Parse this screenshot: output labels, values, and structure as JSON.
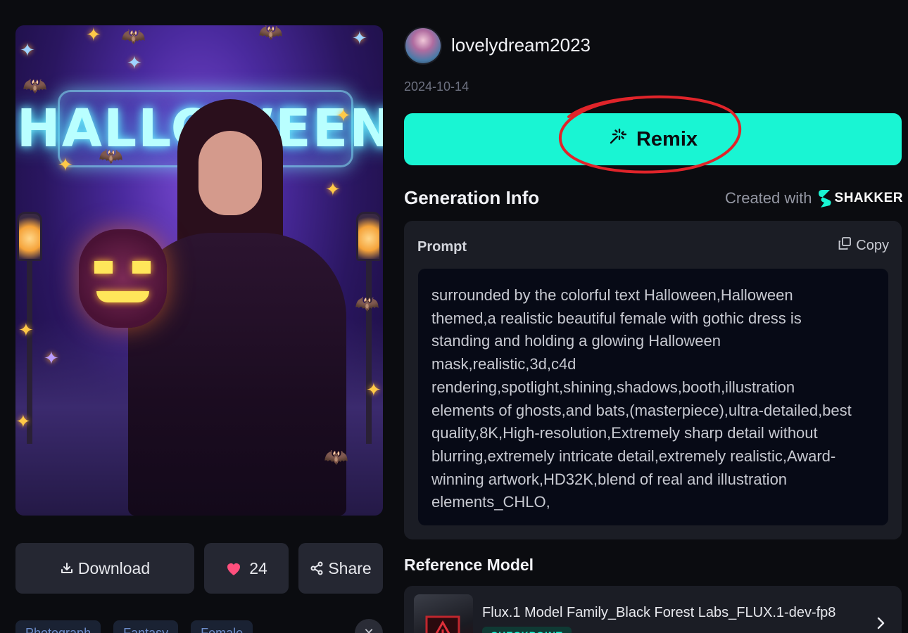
{
  "artwork": {
    "neon_sign": "HALLOWEEN"
  },
  "actions": {
    "download_label": "Download",
    "like_count": "24",
    "share_label": "Share"
  },
  "tags": [
    "Photograph",
    "Fantasy",
    "Female"
  ],
  "author": {
    "username": "lovelydream2023",
    "date": "2024-10-14"
  },
  "remix_label": "Remix",
  "generation_info": {
    "title": "Generation Info",
    "created_with_label": "Created with",
    "brand": "SHAKKER",
    "prompt_label": "Prompt",
    "copy_label": "Copy",
    "prompt_lines": [
      "surrounded by the colorful text Halloween,Halloween",
      "themed,a realistic beautiful female with gothic dress is",
      "standing and holding a glowing Halloween",
      "mask,realistic,3d,c4d",
      "rendering,spotlight,shining,shadows,booth,illustration",
      "elements of ghosts,and bats,(masterpiece),ultra-detailed,best",
      "quality,8K,High-resolution,Extremely sharp detail without",
      "blurring,extremely intricate detail,extremely realistic,Award-",
      "winning artwork,HD32K,blend of real and illustration",
      "elements_CHLO,"
    ]
  },
  "reference_model": {
    "title": "Reference Model",
    "name": "Flux.1 Model Family_Black Forest Labs_FLUX.1-dev-fp8",
    "badge": "CHECKPOINT"
  },
  "colors": {
    "accent": "#19f5d3",
    "background": "#0b0c10",
    "panel": "#1b1d25",
    "annotation": "#e0242a",
    "like": "#ff4f7d"
  }
}
